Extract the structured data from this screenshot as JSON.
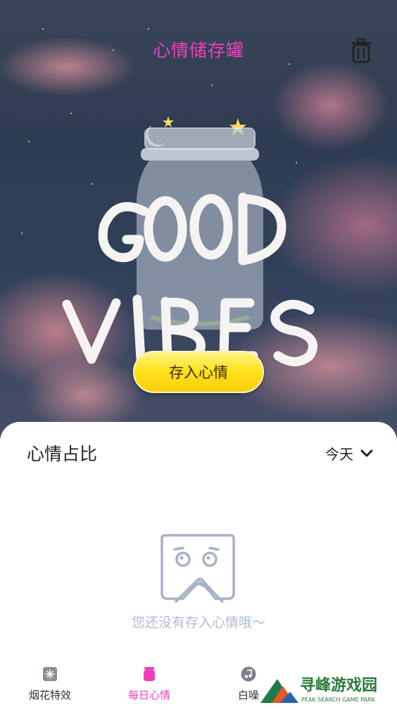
{
  "header": {
    "title": "心情储存罐",
    "trash_icon": "trash-icon",
    "title_color": "#f03fbe"
  },
  "hero": {
    "artwork_text_line1": "GOOD",
    "artwork_text_line2": "VIBES",
    "store_button_label": "存入心情"
  },
  "sheet": {
    "title": "心情占比",
    "period_selected": "今天",
    "empty_text": "您还没有存入心情哦～"
  },
  "tabs": [
    {
      "label": "烟花特效",
      "icon": "fireworks-icon",
      "active": false
    },
    {
      "label": "每日心情",
      "icon": "mood-jar-icon",
      "active": true
    },
    {
      "label": "白噪",
      "icon": "music-icon",
      "active": false
    }
  ],
  "colors": {
    "accent_pink": "#f03fbe",
    "button_yellow": "#ffe21f",
    "empty_text": "#b1bbd0"
  },
  "watermark": {
    "brand": "寻峰游戏园",
    "brand_en": "PEAK SEARCH GAME PARK"
  }
}
